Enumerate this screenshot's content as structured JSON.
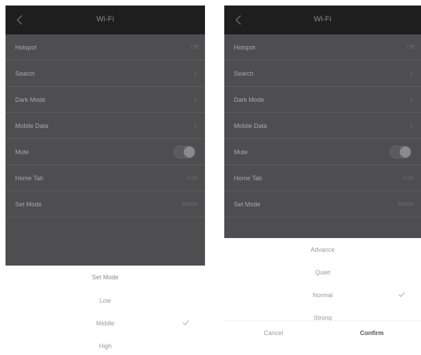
{
  "left": {
    "title": "Wi-Fi",
    "rows": {
      "r0": {
        "label": "Hotspot",
        "value": "Off"
      },
      "r1": {
        "label": "Search"
      },
      "r2": {
        "label": "Dark Mode"
      },
      "r3": {
        "label": "Mobile Data"
      },
      "r4": {
        "label": "Mute"
      },
      "r5": {
        "label": "Home Tab",
        "value": "Auto"
      },
      "r6": {
        "label": "Set Mode",
        "value": "Middle"
      }
    },
    "sheet": {
      "title": "Set Mode",
      "options": [
        "Low",
        "Middle",
        "High"
      ],
      "selected": "Middle"
    }
  },
  "right": {
    "title": "Wi-Fi",
    "rows": {
      "r0": {
        "label": "Hotspot",
        "value": "Off"
      },
      "r1": {
        "label": "Search"
      },
      "r2": {
        "label": "Dark Mode"
      },
      "r3": {
        "label": "Mobile Data"
      },
      "r4": {
        "label": "Mute"
      },
      "r5": {
        "label": "Home Tab",
        "value": "Auto"
      },
      "r6": {
        "label": "Set Mode",
        "value": "Middle"
      }
    },
    "sheet": {
      "options": [
        "Advance",
        "Quiet",
        "Normal",
        "Strong"
      ],
      "selected": "Normal",
      "cancel_label": "Cancel",
      "confirm_label": "Confirm"
    }
  },
  "icons": {
    "back": "arrow-left-icon",
    "chevron": "chevron-right-icon",
    "check": "check-icon"
  },
  "colors": {
    "appbar": "#1e1e1e",
    "list_bg": "#4e4e50",
    "sheet_bg": "#ffffff"
  }
}
